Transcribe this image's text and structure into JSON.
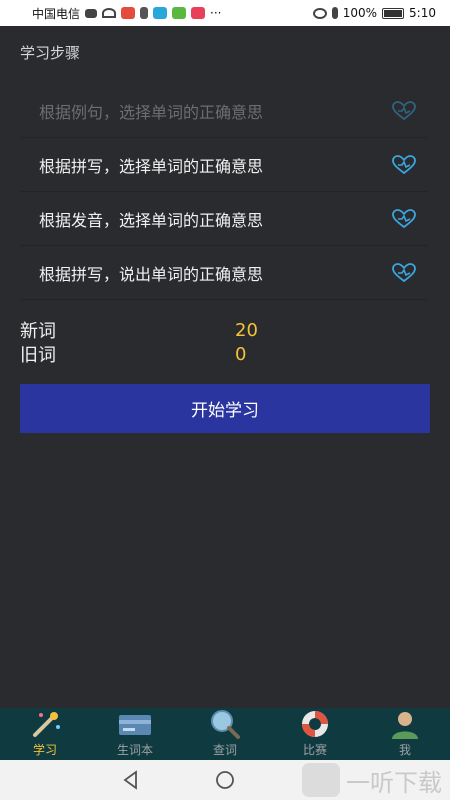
{
  "status_bar": {
    "carrier": "中国电信",
    "battery": "100%",
    "time": "5:10",
    "more": "···"
  },
  "section_title": "学习步骤",
  "steps": [
    {
      "label": "根据例句，选择单词的正确意思",
      "enabled": false
    },
    {
      "label": "根据拼写，选择单词的正确意思",
      "enabled": true
    },
    {
      "label": "根据发音，选择单词的正确意思",
      "enabled": true
    },
    {
      "label": "根据拼写，说出单词的正确意思",
      "enabled": true
    }
  ],
  "counts": {
    "new_label": "新词",
    "new_value": "20",
    "old_label": "旧词",
    "old_value": "0"
  },
  "start_button": "开始学习",
  "tabs": [
    {
      "label": "学习",
      "icon": "magic-wand-icon",
      "active": true
    },
    {
      "label": "生词本",
      "icon": "card-icon",
      "active": false
    },
    {
      "label": "查词",
      "icon": "magnifier-icon",
      "active": false
    },
    {
      "label": "比赛",
      "icon": "lifebuoy-icon",
      "active": false
    },
    {
      "label": "我",
      "icon": "user-icon",
      "active": false
    }
  ],
  "watermark": "一听下载",
  "colors": {
    "background": "#2a2b2e",
    "accent_yellow": "#f4c23a",
    "button_blue": "#2a35a0",
    "heart_blue": "#3aa7e0",
    "tabbar": "#0f3a40"
  }
}
